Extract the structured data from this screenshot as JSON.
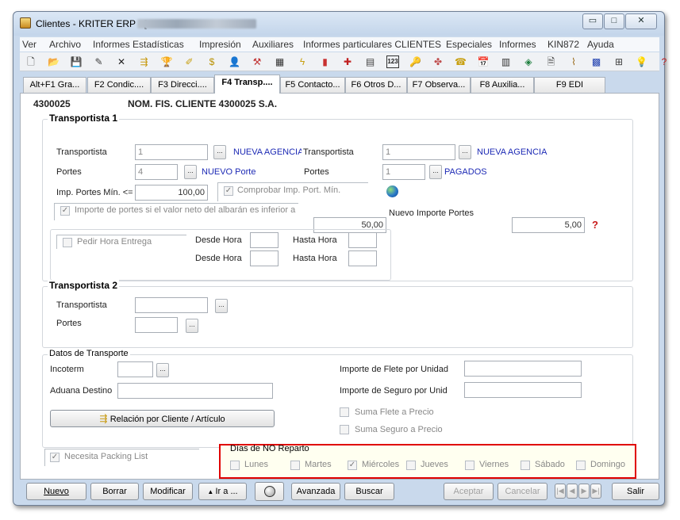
{
  "window": {
    "title": "Clientes - KRITER ERP - [",
    "controls": {
      "minimize": "▭",
      "maximize": "□",
      "close": "✕"
    }
  },
  "menu": [
    "Ver",
    "Archivo",
    "Informes",
    "Estadísticas",
    "Impresión",
    "Auxiliares",
    "Informes particulares CLIENTES",
    "Especiales",
    "Informes",
    "KIN872",
    "Ayuda"
  ],
  "toolbar": {
    "icons": [
      "new-icon",
      "open-icon",
      "save-icon",
      "edit-icon",
      "delete-icon",
      "relation-icon",
      "trophy-icon",
      "pencil-icon",
      "money-icon",
      "user-icon",
      "tools-icon",
      "grid-icon",
      "flash-icon",
      "chart-icon",
      "medkit-icon",
      "card-icon",
      "number-icon",
      "key-icon",
      "colors-icon",
      "phone-icon",
      "calendar-icon",
      "table-icon",
      "tag-icon",
      "document-icon",
      "clip-icon",
      "columns-icon",
      "tree-icon",
      "bulb-icon",
      "help-icon"
    ],
    "glyphs": [
      "🗋",
      "📂",
      "💾",
      "✎",
      "✕",
      "⇶",
      "🏆",
      "✐",
      "$",
      "👤",
      "⚒",
      "▦",
      "ϟ",
      "▮",
      "✚",
      "▤",
      "123",
      "🔑",
      "✤",
      "☎",
      "📅",
      "▥",
      "◈",
      "🗎",
      "⌇",
      "▩",
      "⊞",
      "💡",
      "?"
    ],
    "colors": [
      "#333333",
      "#c8961c",
      "#707070",
      "#404040",
      "#222222",
      "#c89a12",
      "#c8a012",
      "#c8a012",
      "#b89000",
      "#505050",
      "#c03030",
      "#303030",
      "#c8a012",
      "#c83030",
      "#c02020",
      "#404040",
      "#202020",
      "#c8a012",
      "#c05050",
      "#c8a012",
      "#3060b0",
      "#303030",
      "#208040",
      "#404040",
      "#9a6a1a",
      "#2040b0",
      "#404040",
      "#e0b000",
      "#c02020"
    ]
  },
  "tabs": [
    {
      "label": "Alt+F1 Gra...",
      "active": false
    },
    {
      "label": "F2 Condic....",
      "active": false
    },
    {
      "label": "F3 Direcci....",
      "active": false
    },
    {
      "label": "F4 Transp....",
      "active": true
    },
    {
      "label": "F5 Contacto...",
      "active": false
    },
    {
      "label": "F6 Otros D...",
      "active": false
    },
    {
      "label": "F7 Observa...",
      "active": false
    },
    {
      "label": "F8 Auxilia...",
      "active": false
    },
    {
      "label": "F9 EDI",
      "active": false
    }
  ],
  "client": {
    "code": "4300025",
    "name": "NOM. FIS. CLIENTE 4300025 S.A."
  },
  "transportista1": {
    "title": "Transportista 1",
    "transportista_label": "Transportista",
    "transportista_value": "1",
    "transportista_name": "NUEVA AGENCIA",
    "portes_label": "Portes",
    "portes_value": "4",
    "portes_name": "NUEVO Porte",
    "transportista2_label": "Transportista",
    "transportista2_value": "1",
    "transportista2_name": "NUEVA AGENCIA",
    "portes2_label": "Portes",
    "portes2_value": "1",
    "portes2_name": "PAGADOS",
    "imp_portes_min_label": "Imp. Portes Mín. <=",
    "imp_portes_min_value": "100,00",
    "comprobar_label": "Comprobar Imp. Port. Mín.",
    "comprobar_checked": true,
    "importe_portes_label": "Importe de portes si el valor neto del albarán es inferior a",
    "importe_portes_checked": true,
    "importe_portes_value": "50,00",
    "nuevo_importe_label": "Nuevo Importe Portes",
    "nuevo_importe_value": "5,00",
    "pedir_hora_label": "Pedir Hora Entrega",
    "pedir_hora_checked": false,
    "desde_hora_label": "Desde Hora",
    "hasta_hora_label": "Hasta Hora"
  },
  "transportista2": {
    "title": "Transportista 2",
    "transportista_label": "Transportista",
    "portes_label": "Portes"
  },
  "datos_transporte": {
    "title": "Datos de Transporte",
    "incoterm_label": "Incoterm",
    "aduana_label": "Aduana Destino",
    "flete_label": "Importe de Flete por Unidad",
    "seguro_label": "Importe de Seguro por Unid",
    "relacion_button": "Relación por Cliente / Artículo",
    "suma_flete_label": "Suma Flete a Precio",
    "suma_seguro_label": "Suma Seguro a Precio"
  },
  "packing": {
    "label": "Necesita Packing List",
    "checked": true
  },
  "dias_no_reparto": {
    "title": "Días de NO Reparto",
    "highlight_color": "#e00000",
    "days": [
      {
        "label": "Lunes",
        "checked": false
      },
      {
        "label": "Martes",
        "checked": false
      },
      {
        "label": "Miércoles",
        "checked": true
      },
      {
        "label": "Jueves",
        "checked": false
      },
      {
        "label": "Viernes",
        "checked": false
      },
      {
        "label": "Sábado",
        "checked": false
      },
      {
        "label": "Domingo",
        "checked": false
      }
    ]
  },
  "footer": {
    "nuevo": "Nuevo",
    "borrar": "Borrar",
    "modificar": "Modificar",
    "ira": "Ir a ...",
    "avanzada": "Avanzada",
    "buscar": "Buscar",
    "aceptar": "Aceptar",
    "cancelar": "Cancelar",
    "salir": "Salir"
  }
}
